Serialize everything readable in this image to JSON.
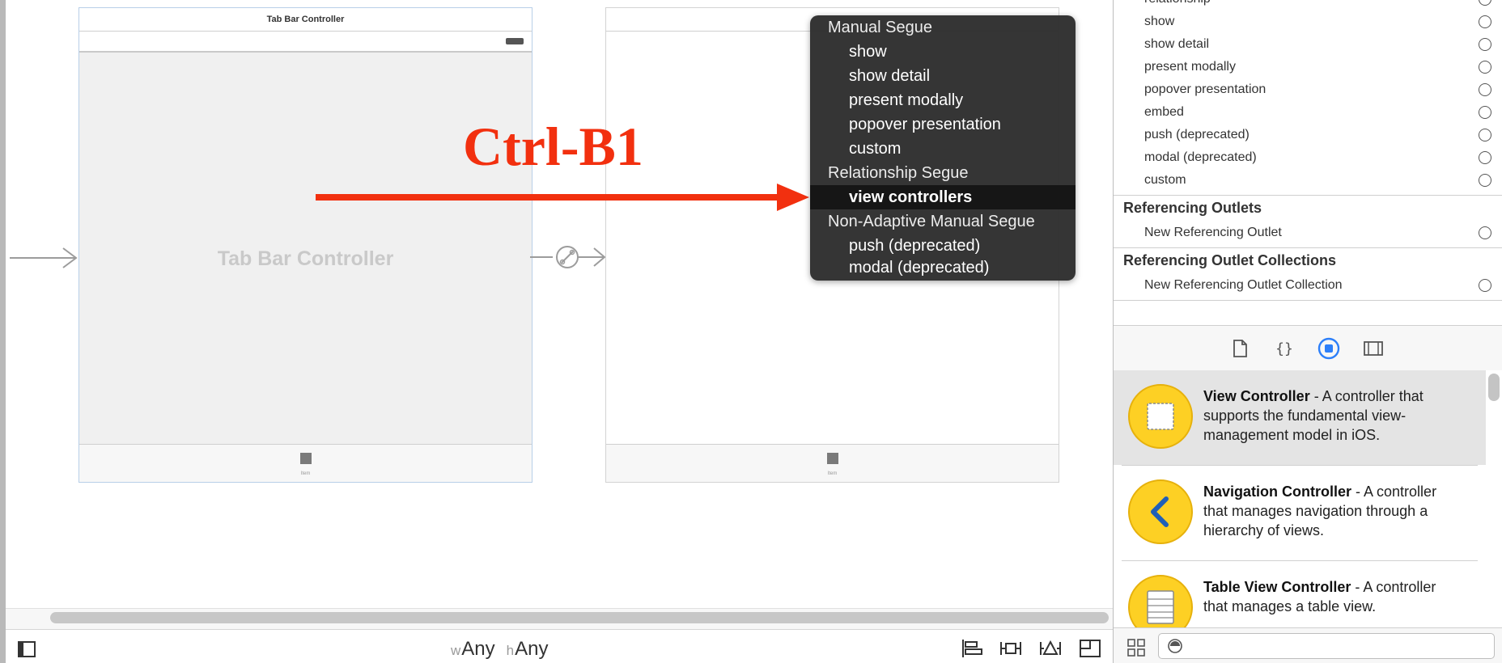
{
  "canvas": {
    "tab_bar_scene": {
      "title": "Tab Bar Controller",
      "center_label": "Tab Bar Controller",
      "tab_label": "Item"
    },
    "view_controller_scene": {
      "tab_label": "Item"
    },
    "annotation": {
      "text": "Ctrl-B1",
      "color": "#f2300f"
    },
    "size_class": {
      "w_prefix": "w",
      "w_value": "Any",
      "h_prefix": "h",
      "h_value": "Any"
    }
  },
  "segue_menu": {
    "groups": [
      {
        "header": "Manual Segue",
        "items": [
          "show",
          "show detail",
          "present modally",
          "popover presentation",
          "custom"
        ]
      },
      {
        "header": "Relationship Segue",
        "items": [
          "view controllers"
        ]
      },
      {
        "header": "Non-Adaptive Manual Segue",
        "items": [
          "push (deprecated)",
          "modal (deprecated)"
        ]
      }
    ],
    "selected": "view controllers"
  },
  "connections_inspector": {
    "triggered_segues": [
      "relationship",
      "show",
      "show detail",
      "present modally",
      "popover presentation",
      "embed",
      "push (deprecated)",
      "modal (deprecated)",
      "custom"
    ],
    "referencing_outlets": {
      "title": "Referencing Outlets",
      "item": "New Referencing Outlet"
    },
    "referencing_outlet_collections": {
      "title": "Referencing Outlet Collections",
      "item": "New Referencing Outlet Collection"
    }
  },
  "library_tabs": [
    "file-template-icon",
    "code-snippet-icon",
    "object-library-icon",
    "media-library-icon"
  ],
  "object_library": [
    {
      "name": "View Controller",
      "description": " - A controller that supports the fundamental view-management model in iOS.",
      "icon": "view-controller-icon",
      "selected": true
    },
    {
      "name": "Navigation Controller",
      "description": " - A controller that manages navigation through a hierarchy of views.",
      "icon": "navigation-controller-icon",
      "selected": false
    },
    {
      "name": "Table View Controller",
      "description": " - A controller that manages a table view.",
      "icon": "table-view-controller-icon",
      "selected": false
    }
  ],
  "colors": {
    "accent_blue": "#2d7ff9",
    "icon_yellow": "#fdd024",
    "menu_background": "#2d2d2d"
  }
}
